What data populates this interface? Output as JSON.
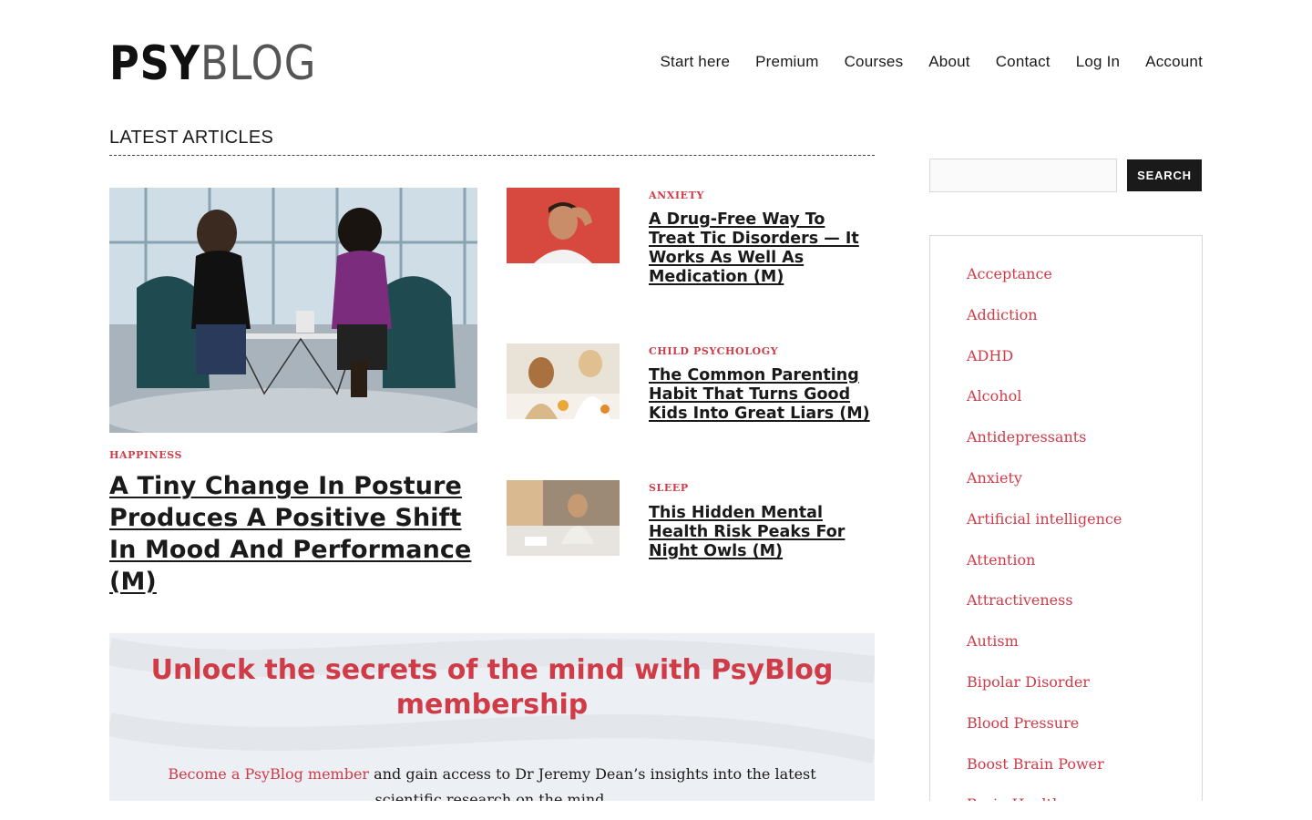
{
  "logo": {
    "part1": "PSY",
    "part2": "BLOG"
  },
  "nav": {
    "items": [
      "Start here",
      "Premium",
      "Courses",
      "About",
      "Contact",
      "Log In",
      "Account"
    ]
  },
  "section": {
    "title": "LATEST ARTICLES"
  },
  "featured": {
    "category": "HAPPINESS",
    "title": "A Tiny Change In Posture Produces A Positive Shift In Mood And Performance (M)",
    "image": "two-women-laptops-office-photo"
  },
  "articles": [
    {
      "category": "ANXIETY",
      "title": "A Drug-Free Way To Treat Tic Disorders — It Works As Well As Medication (M)",
      "image": "man-hand-on-head-photo"
    },
    {
      "category": "CHILD PSYCHOLOGY",
      "title": "The Common Parenting Habit That Turns Good Kids Into Great Liars (M)",
      "image": "mother-daughter-breakfast-photo"
    },
    {
      "category": "SLEEP",
      "title": "This Hidden Mental Health Risk Peaks For Night Owls (M)",
      "image": "man-sitting-on-bed-photo"
    }
  ],
  "membership": {
    "title": "Unlock the secrets of the mind with PsyBlog membership",
    "link_text": "Become a PsyBlog member",
    "body": " and gain access to Dr Jeremy Dean’s insights into the latest scientific research on the mind."
  },
  "sidebar": {
    "search_button": "SEARCH",
    "search_placeholder": "",
    "categories": [
      "Acceptance",
      "Addiction",
      "ADHD",
      "Alcohol",
      "Antidepressants",
      "Anxiety",
      "Artificial intelligence",
      "Attention",
      "Attractiveness",
      "Autism",
      "Bipolar Disorder",
      "Blood Pressure",
      "Boost Brain Power",
      "Brain Health"
    ]
  },
  "colors": {
    "accent": "#d03b48",
    "text": "#1a1a1a",
    "button": "#1a1a1a",
    "member_bg": "#eceff3"
  }
}
